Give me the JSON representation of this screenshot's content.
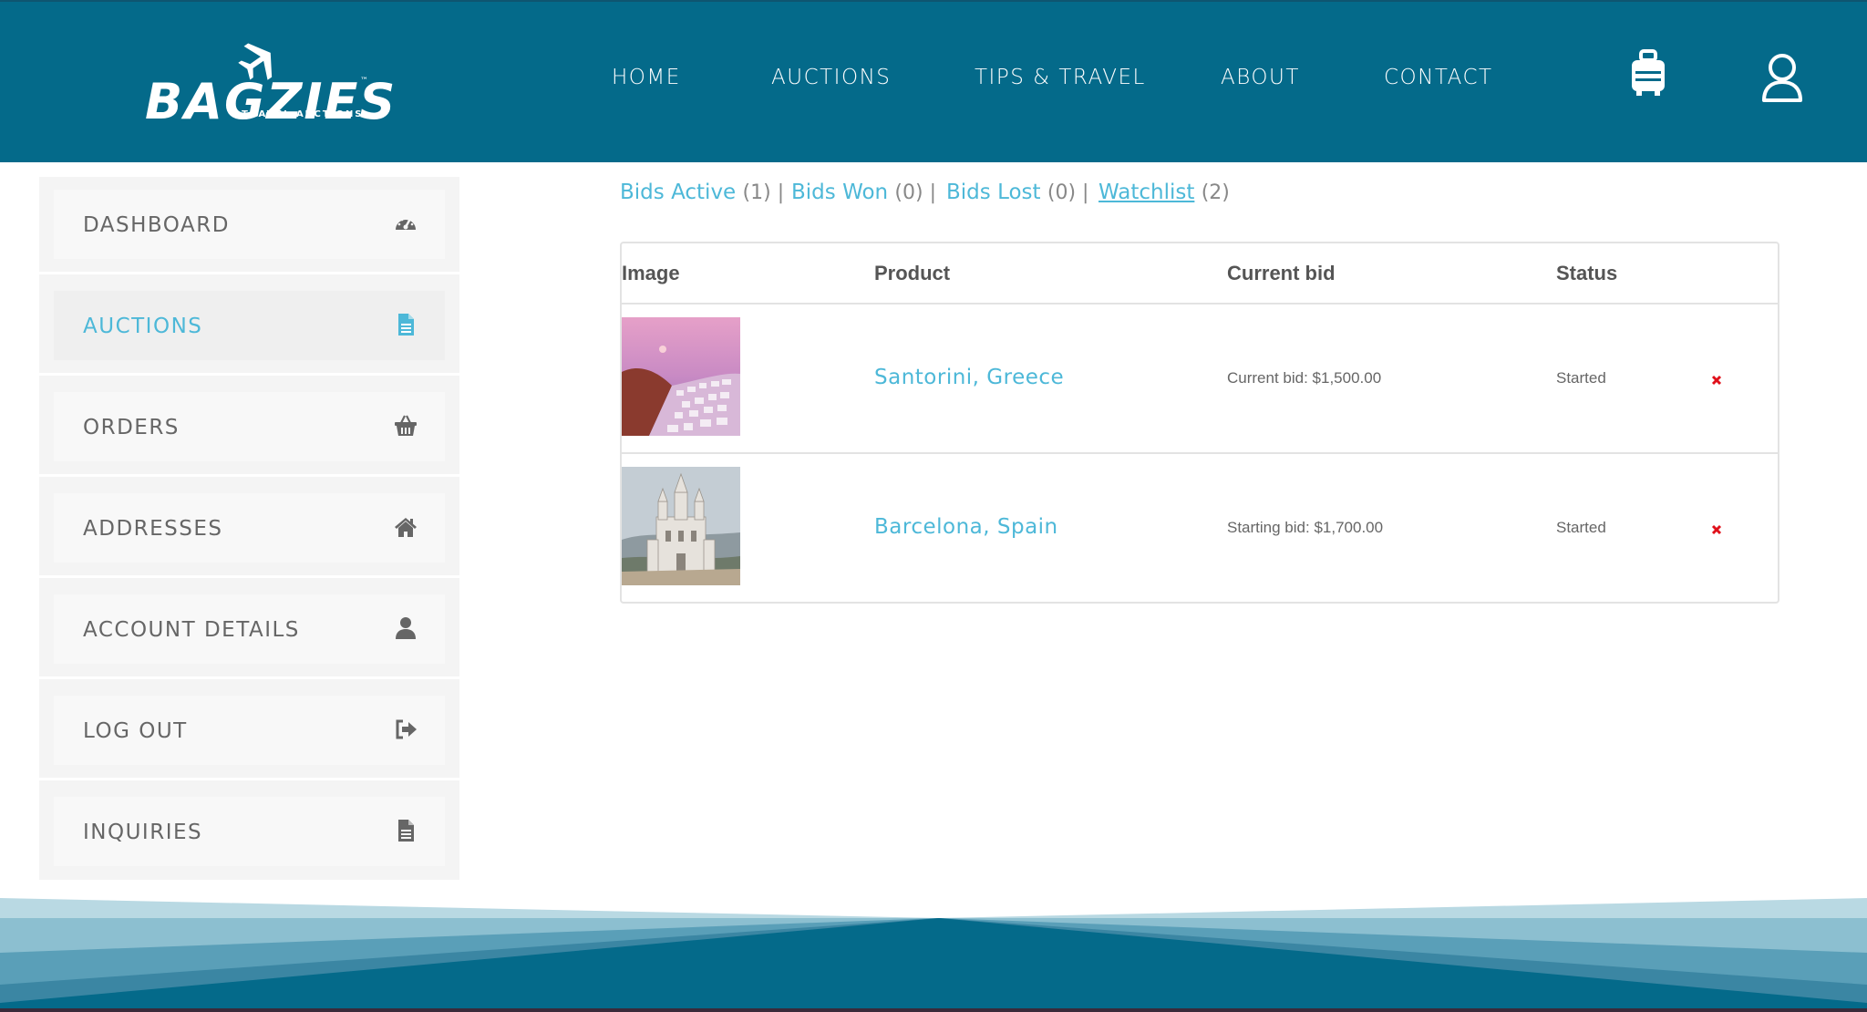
{
  "brand": {
    "name": "BAGZIES",
    "tagline": "TRAVEL AUCTIONS",
    "tm": "™"
  },
  "nav": [
    {
      "label": "HOME"
    },
    {
      "label": "AUCTIONS"
    },
    {
      "label": "TIPS & TRAVEL"
    },
    {
      "label": "ABOUT"
    },
    {
      "label": "CONTACT"
    }
  ],
  "header_icons": [
    "luggage-icon",
    "user-account-icon"
  ],
  "sidebar": {
    "items": [
      {
        "label": "DASHBOARD",
        "icon": "dashboard-gauge-icon",
        "active": false
      },
      {
        "label": "AUCTIONS",
        "icon": "document-icon",
        "active": true
      },
      {
        "label": "ORDERS",
        "icon": "basket-icon",
        "active": false
      },
      {
        "label": "ADDRESSES",
        "icon": "home-icon",
        "active": false
      },
      {
        "label": "ACCOUNT DETAILS",
        "icon": "user-icon",
        "active": false
      },
      {
        "label": "LOG OUT",
        "icon": "sign-out-icon",
        "active": false
      },
      {
        "label": "INQUIRIES",
        "icon": "file-icon",
        "active": false
      }
    ]
  },
  "tabs": [
    {
      "label": "Bids Active",
      "count": "(1) |"
    },
    {
      "label": "Bids Won",
      "count": "(0) |"
    },
    {
      "label": "Bids Lost",
      "count": "(0) |"
    },
    {
      "label": "Watchlist",
      "count": "(2)",
      "current": true
    }
  ],
  "table": {
    "headers": [
      "Image",
      "Product",
      "Current bid",
      "Status"
    ],
    "rows": [
      {
        "product": "Santorini, Greece",
        "bid": "Current bid: $1,500.00",
        "status": "Started",
        "image": "santorini-thumbnail"
      },
      {
        "product": "Barcelona, Spain",
        "bid": "Starting bid: $1,700.00",
        "status": "Started",
        "image": "barcelona-thumbnail"
      }
    ]
  },
  "colors": {
    "header_bg": "#046a8a",
    "link": "#4db8d8",
    "remove_icon": "#e0101a"
  }
}
